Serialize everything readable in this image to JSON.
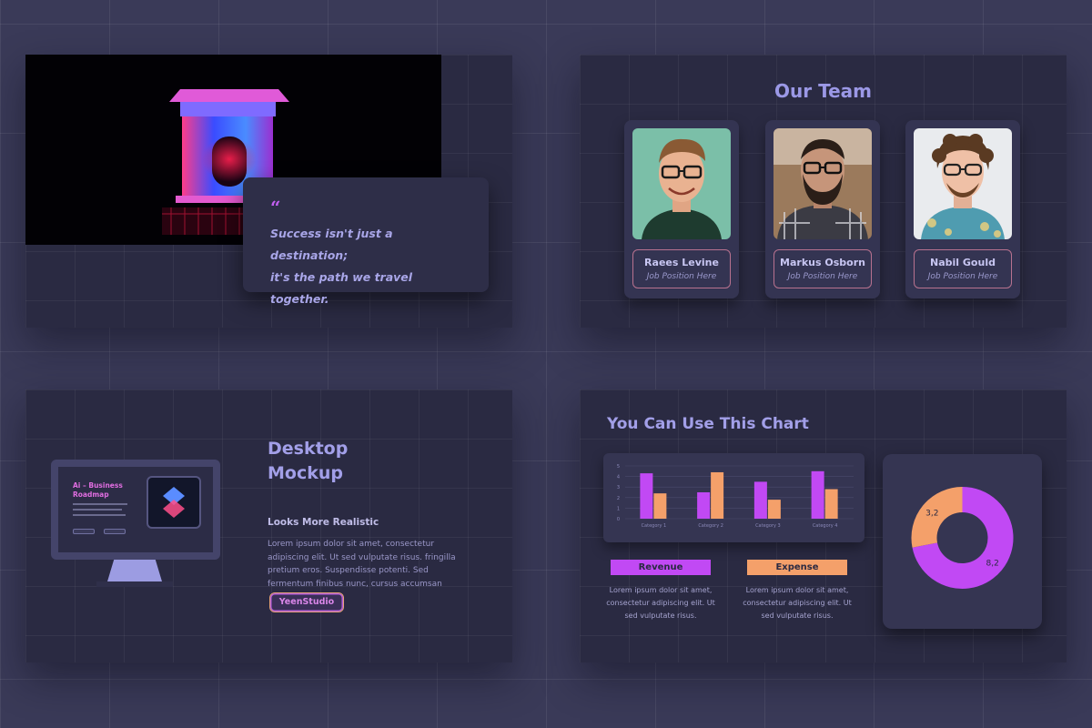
{
  "slide1": {
    "quote_mark": "“",
    "quote_line1": "Success isn't just a destination;",
    "quote_line2": "it's the path we travel together."
  },
  "slide2": {
    "title": "Our Team",
    "members": [
      {
        "name": "Raees Levine",
        "position": "Job Position Here"
      },
      {
        "name": "Markus Osborn",
        "position": "Job Position Here"
      },
      {
        "name": "Nabil Gould",
        "position": "Job Position Here"
      }
    ]
  },
  "slide3": {
    "screen_title": "Ai – Business Roadmap",
    "title": "Desktop\nMockup",
    "subtitle": "Looks More Realistic",
    "body": "Lorem ipsum dolor sit amet, consectetur adipiscing elit. Ut sed vulputate risus. fringilla pretium eros. Suspendisse potenti. Sed fermentum finibus nunc, cursus accumsan",
    "button": "YeenStudio"
  },
  "slide4": {
    "title": "You Can Use This Chart",
    "revenue_label": "Revenue",
    "expense_label": "Expense",
    "revenue_desc": "Lorem ipsum dolor sit amet, consectetur adipiscing elit. Ut sed vulputate risus.",
    "expense_desc": "Lorem ipsum dolor sit amet, consectetur adipiscing elit. Ut sed vulputate risus."
  },
  "colors": {
    "revenue": "#c149f4",
    "expense": "#f4a06a",
    "background": "#3a3a58",
    "slide": "#2a2a42"
  },
  "chart_data": [
    {
      "type": "bar",
      "categories": [
        "Category 1",
        "Category 2",
        "Category 3",
        "Category 4"
      ],
      "series": [
        {
          "name": "Revenue",
          "values": [
            4.3,
            2.5,
            3.5,
            4.5
          ]
        },
        {
          "name": "Expense",
          "values": [
            2.4,
            4.4,
            1.8,
            2.8
          ]
        }
      ],
      "yticks": [
        0,
        1,
        2,
        3,
        4,
        5
      ],
      "ylim": [
        0,
        5
      ],
      "grid": true
    },
    {
      "type": "pie",
      "donut": true,
      "labels": [
        "Revenue",
        "Expense"
      ],
      "values": [
        8.2,
        3.2
      ],
      "value_labels": [
        "8,2",
        "3,2"
      ]
    }
  ]
}
